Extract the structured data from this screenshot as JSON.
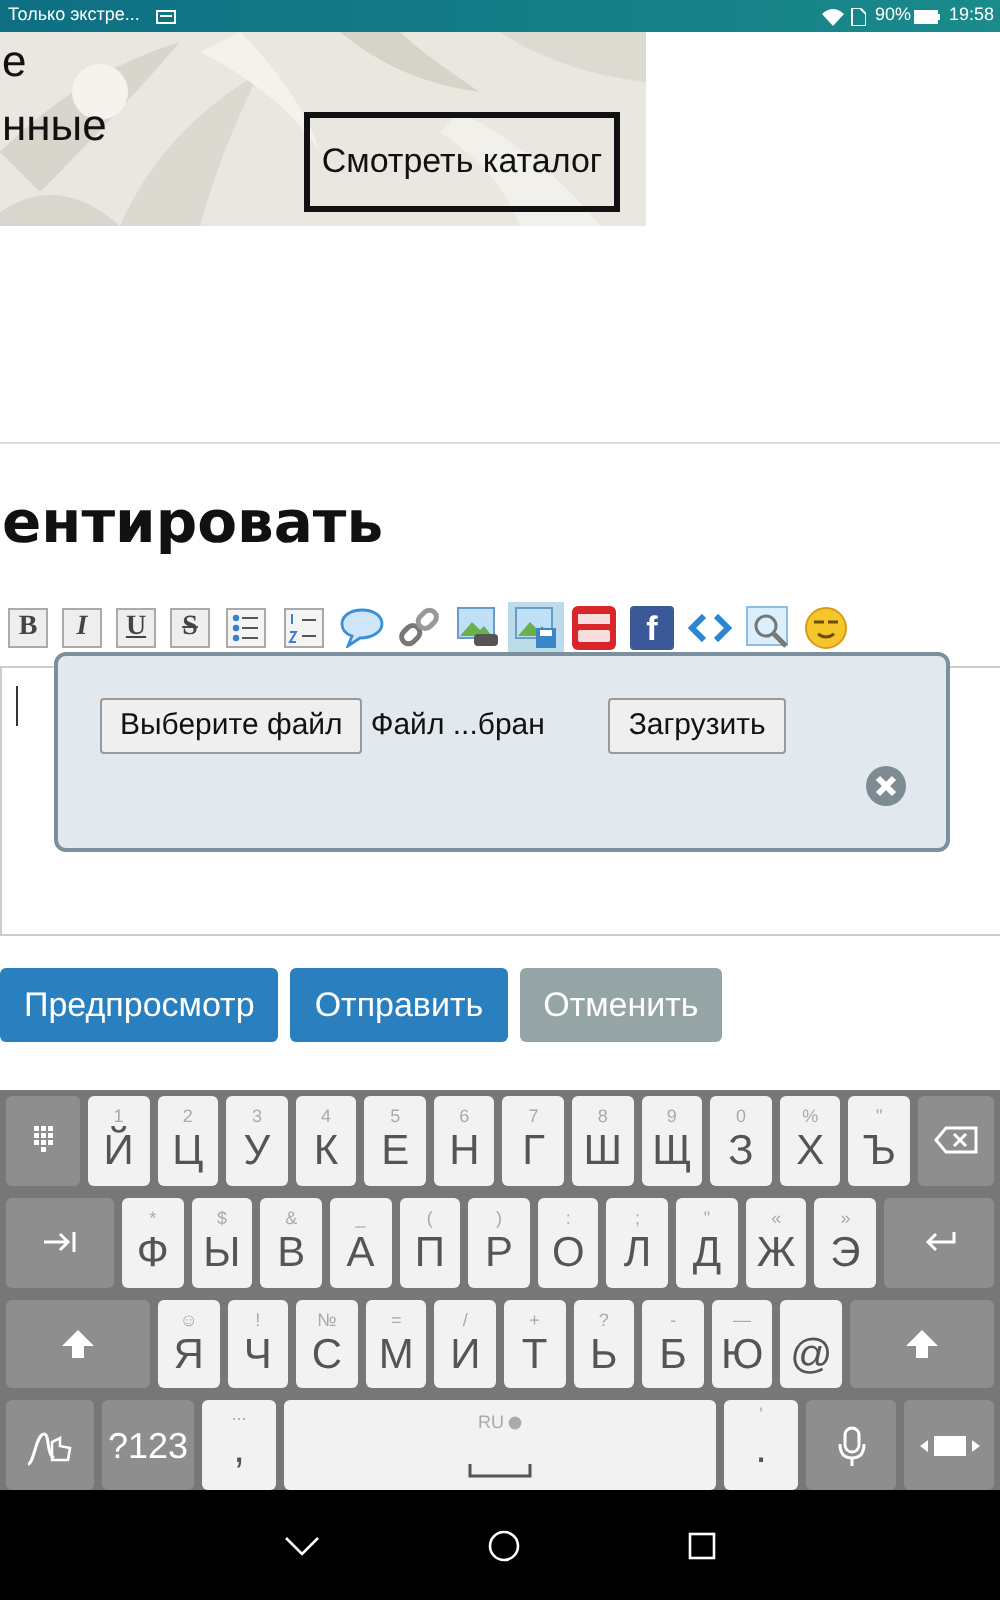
{
  "status_bar": {
    "notification": "Только экстре...",
    "battery": "90%",
    "time": "19:58"
  },
  "banner": {
    "lines": [
      "е",
      "нные"
    ],
    "button": "Смотреть каталог"
  },
  "heading": "ентировать",
  "toolbar": [
    {
      "kind": "bold",
      "label": "B",
      "selected": false
    },
    {
      "kind": "italic",
      "label": "I",
      "selected": false
    },
    {
      "kind": "underline",
      "label": "U",
      "selected": false
    },
    {
      "kind": "strike",
      "label": "S",
      "selected": false
    },
    {
      "kind": "bullet-list",
      "selected": false
    },
    {
      "kind": "numbered-list",
      "selected": false
    },
    {
      "kind": "quote",
      "selected": false
    },
    {
      "kind": "link",
      "selected": false
    },
    {
      "kind": "image-link",
      "selected": false
    },
    {
      "kind": "image-upload",
      "selected": true
    },
    {
      "kind": "video",
      "selected": false
    },
    {
      "kind": "facebook",
      "label": "f",
      "selected": false
    },
    {
      "kind": "code",
      "selected": false
    },
    {
      "kind": "preview",
      "selected": false
    },
    {
      "kind": "smiley",
      "selected": false
    }
  ],
  "upload_popup": {
    "choose_button": "Выберите файл",
    "file_status": "Файл ...бран",
    "upload_button": "Загрузить"
  },
  "actions": [
    {
      "label": "Предпросмотр",
      "kind": "primary"
    },
    {
      "label": "Отправить",
      "kind": "primary"
    },
    {
      "label": "Отменить",
      "kind": "secondary"
    }
  ],
  "keyboard": {
    "rows": [
      [
        {
          "kind": "layout"
        },
        {
          "kind": "letter",
          "label": "Й",
          "hint": "1"
        },
        {
          "kind": "letter",
          "label": "Ц",
          "hint": "2"
        },
        {
          "kind": "letter",
          "label": "У",
          "hint": "3"
        },
        {
          "kind": "letter",
          "label": "К",
          "hint": "4"
        },
        {
          "kind": "letter",
          "label": "Е",
          "hint": "5"
        },
        {
          "kind": "letter",
          "label": "Н",
          "hint": "6"
        },
        {
          "kind": "letter",
          "label": "Г",
          "hint": "7"
        },
        {
          "kind": "letter",
          "label": "Ш",
          "hint": "8"
        },
        {
          "kind": "letter",
          "label": "Щ",
          "hint": "9"
        },
        {
          "kind": "letter",
          "label": "З",
          "hint": "0"
        },
        {
          "kind": "letter",
          "label": "Х",
          "hint": "%"
        },
        {
          "kind": "letter",
          "label": "Ъ",
          "hint": "\""
        },
        {
          "kind": "backspace"
        }
      ],
      [
        {
          "kind": "tab"
        },
        {
          "kind": "letter",
          "label": "Ф",
          "hint": "*"
        },
        {
          "kind": "letter",
          "label": "Ы",
          "hint": "$"
        },
        {
          "kind": "letter",
          "label": "В",
          "hint": "&"
        },
        {
          "kind": "letter",
          "label": "А",
          "hint": "_"
        },
        {
          "kind": "letter",
          "label": "П",
          "hint": "("
        },
        {
          "kind": "letter",
          "label": "Р",
          "hint": ")"
        },
        {
          "kind": "letter",
          "label": "О",
          "hint": ":"
        },
        {
          "kind": "letter",
          "label": "Л",
          "hint": ";"
        },
        {
          "kind": "letter",
          "label": "Д",
          "hint": "\""
        },
        {
          "kind": "letter",
          "label": "Ж",
          "hint": "«"
        },
        {
          "kind": "letter",
          "label": "Э",
          "hint": "»"
        },
        {
          "kind": "enter"
        }
      ],
      [
        {
          "kind": "shift"
        },
        {
          "kind": "letter",
          "label": "Я",
          "hint": "☺"
        },
        {
          "kind": "letter",
          "label": "Ч",
          "hint": "!"
        },
        {
          "kind": "letter",
          "label": "С",
          "hint": "№"
        },
        {
          "kind": "letter",
          "label": "М",
          "hint": "="
        },
        {
          "kind": "letter",
          "label": "И",
          "hint": "/"
        },
        {
          "kind": "letter",
          "label": "Т",
          "hint": "+"
        },
        {
          "kind": "letter",
          "label": "Ь",
          "hint": "?"
        },
        {
          "kind": "letter",
          "label": "Б",
          "hint": "-"
        },
        {
          "kind": "letter",
          "label": "Ю",
          "hint": "—"
        },
        {
          "kind": "letter",
          "label": "@"
        },
        {
          "kind": "shift"
        }
      ],
      [
        {
          "kind": "gesture"
        },
        {
          "kind": "symbols",
          "label": "?123"
        },
        {
          "kind": "punct",
          "label": ",",
          "hint": "..."
        },
        {
          "kind": "space",
          "hint": "RU"
        },
        {
          "kind": "punct",
          "label": ".",
          "hint": "'"
        },
        {
          "kind": "mic"
        },
        {
          "kind": "keyboard-mode"
        }
      ]
    ]
  }
}
